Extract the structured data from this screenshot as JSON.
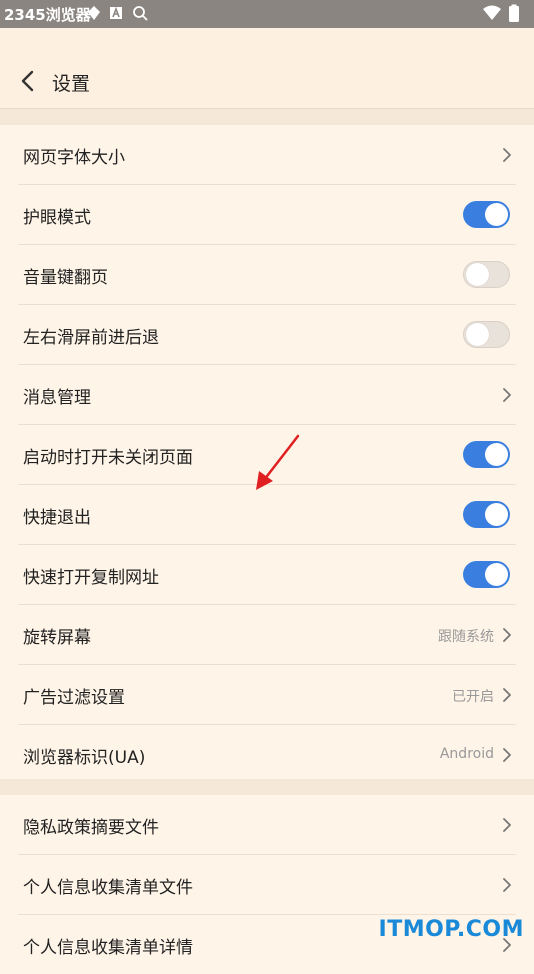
{
  "status_bar": {
    "app_name": "2345浏览器"
  },
  "header": {
    "title": "设置"
  },
  "settings_group_1": [
    {
      "label": "网页字体大小",
      "type": "chevron"
    },
    {
      "label": "护眼模式",
      "type": "toggle",
      "on": true
    },
    {
      "label": "音量键翻页",
      "type": "toggle",
      "on": false
    },
    {
      "label": "左右滑屏前进后退",
      "type": "toggle",
      "on": false
    },
    {
      "label": "消息管理",
      "type": "chevron"
    },
    {
      "label": "启动时打开未关闭页面",
      "type": "toggle",
      "on": true
    },
    {
      "label": "快捷退出",
      "type": "toggle",
      "on": true
    },
    {
      "label": "快速打开复制网址",
      "type": "toggle",
      "on": true
    },
    {
      "label": "旋转屏幕",
      "type": "value",
      "value": "跟随系统"
    },
    {
      "label": "广告过滤设置",
      "type": "value",
      "value": "已开启"
    },
    {
      "label": "浏览器标识(UA)",
      "type": "value",
      "value": "Android"
    }
  ],
  "settings_group_2": [
    {
      "label": "隐私政策摘要文件",
      "type": "chevron"
    },
    {
      "label": "个人信息收集清单文件",
      "type": "chevron"
    },
    {
      "label": "个人信息收集清单详情",
      "type": "chevron"
    }
  ],
  "watermark": "ITMOP.COM",
  "colors": {
    "background": "#fdf0e1",
    "toggle_on": "#3a7fe0",
    "toggle_off": "#e8e2da",
    "annotation_arrow": "#e02020"
  }
}
